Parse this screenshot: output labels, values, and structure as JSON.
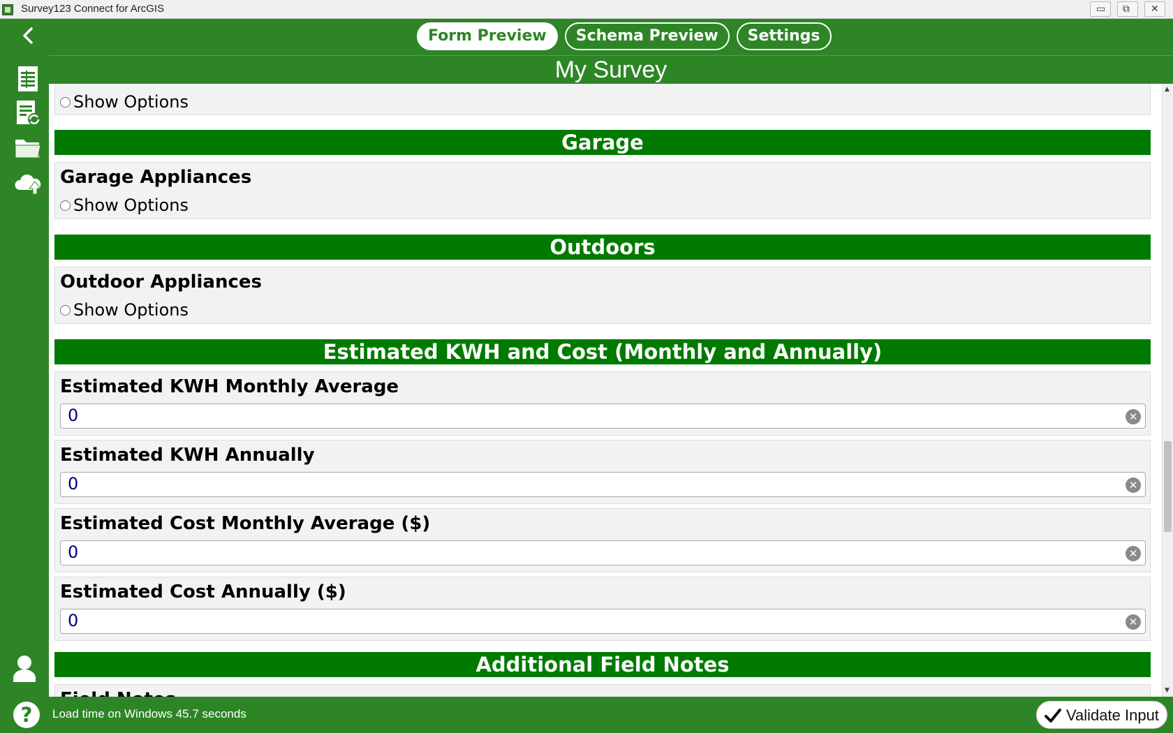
{
  "window": {
    "title": "Survey123 Connect for ArcGIS",
    "controls": {
      "minimize": "▭",
      "restore": "⧉",
      "close": "✕"
    }
  },
  "tabs": [
    {
      "label": "Form Preview",
      "active": true
    },
    {
      "label": "Schema Preview",
      "active": false
    },
    {
      "label": "Settings",
      "active": false
    }
  ],
  "survey": {
    "title": "My Survey"
  },
  "sidebar": {
    "icons": [
      "survey-form-icon",
      "refresh-form-icon",
      "folder-icon",
      "cloud-upload-icon"
    ],
    "bottom_icon": "user-icon"
  },
  "form": {
    "top_partial": {
      "option_label": "Show Options"
    },
    "sections": [
      {
        "header": "Garage",
        "question": "Garage Appliances",
        "option_label": "Show Options"
      },
      {
        "header": "Outdoors",
        "question": "Outdoor Appliances",
        "option_label": "Show Options"
      },
      {
        "header": "Estimated KWH and Cost (Monthly and Annually)",
        "fields": [
          {
            "label": "Estimated KWH Monthly Average",
            "value": "0"
          },
          {
            "label": "Estimated KWH Annually",
            "value": "0"
          },
          {
            "label": "Estimated Cost Monthly Average ($)",
            "value": "0"
          },
          {
            "label": "Estimated Cost Annually ($)",
            "value": "0"
          }
        ]
      },
      {
        "header": "Additional Field Notes",
        "question": "Field Notes"
      }
    ],
    "clear_icon": "clear-circle-icon"
  },
  "footer": {
    "status": "Load time on Windows 45.7 seconds",
    "help_glyph": "?",
    "validate_label": "Validate Input"
  },
  "colors": {
    "frame_green": "#2d8526",
    "header_green": "#007a00",
    "input_text": "#00007a"
  }
}
